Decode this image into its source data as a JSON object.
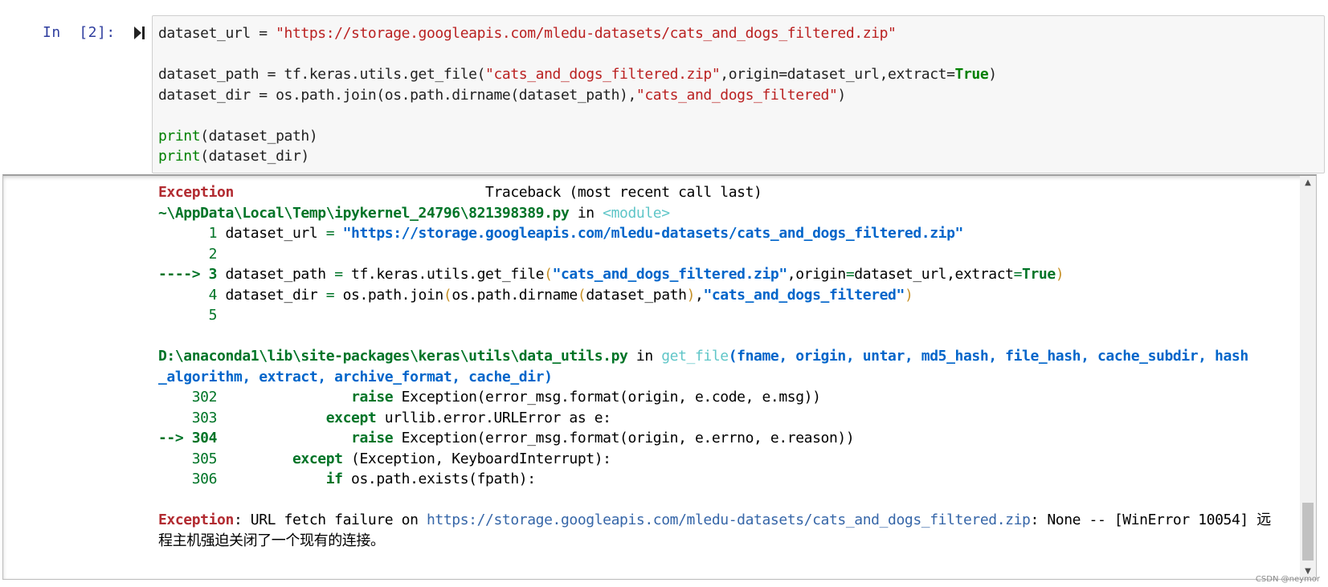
{
  "cell": {
    "prompt": "In  [2]:",
    "input_lines": [
      [
        "dataset_url = ",
        "\"https://storage.googleapis.com/mledu-datasets/cats_and_dogs_filtered.zip\""
      ],
      [],
      [
        "dataset_path = tf.keras.utils.get_file(",
        "\"cats_and_dogs_filtered.zip\"",
        ",origin=dataset_url,extract=",
        "True",
        ")"
      ],
      [
        "dataset_dir = os.path.join(os.path.dirname(dataset_path),",
        "\"cats_and_dogs_filtered\"",
        ")"
      ],
      [],
      [
        "print",
        "(dataset_path)"
      ],
      [
        "print",
        "(dataset_dir)"
      ]
    ]
  },
  "output": {
    "exception_header": {
      "name": "Exception",
      "spacer": "                              ",
      "traceback": "Traceback (most recent call last)"
    },
    "frame1": {
      "file": "~\\AppData\\Local\\Temp\\ipykernel_24796\\821398389.py",
      "in_word": " in ",
      "func": "<module>",
      "lines": [
        {
          "marker": "      ",
          "num": "1",
          "code": [
            " dataset_url ",
            "=",
            " ",
            "\"https://storage.googleapis.com/mledu-datasets/cats_and_dogs_filtered.zip\""
          ]
        },
        {
          "marker": "      ",
          "num": "2",
          "code": []
        },
        {
          "marker": "----> ",
          "num": "3",
          "code": [
            " dataset_path ",
            "=",
            " tf.keras.utils.get_file",
            "(",
            "\"cats_and_dogs_filtered.zip\"",
            ",",
            "origin",
            "=",
            "dataset_url",
            ",",
            "extract",
            "=",
            "True",
            ")"
          ]
        },
        {
          "marker": "      ",
          "num": "4",
          "code": [
            " dataset_dir ",
            "=",
            " os.path.join",
            "(",
            "os.path.dirname",
            "(",
            "dataset_path",
            ")",
            ",",
            "\"cats_and_dogs_filtered\"",
            ")"
          ]
        },
        {
          "marker": "      ",
          "num": "5",
          "code": []
        }
      ]
    },
    "frame2": {
      "file": "D:\\anaconda1\\lib\\site-packages\\keras\\utils\\data_utils.py",
      "in_word": " in ",
      "func": "get_file",
      "args_line1": "(fname, origin, untar, md5_hash, file_hash, cache_subdir, hash",
      "args_line2": "_algorithm, extract, archive_format, cache_dir)",
      "lines": [
        {
          "marker": "    ",
          "num": "302",
          "indent": "                ",
          "kw": "raise",
          "rest": " Exception(error_msg.format(origin, e.code, e.msg))"
        },
        {
          "marker": "    ",
          "num": "303",
          "indent": "             ",
          "kw": "except",
          "rest": " urllib.error.URLError as e:"
        },
        {
          "marker": "--> ",
          "num": "304",
          "indent": "                ",
          "kw": "raise",
          "rest": " Exception(error_msg.format(origin, e.errno, e.reason))"
        },
        {
          "marker": "    ",
          "num": "305",
          "indent": "         ",
          "kw": "except",
          "rest": " (Exception, KeyboardInterrupt):"
        },
        {
          "marker": "    ",
          "num": "306",
          "indent": "             ",
          "kw": "if",
          "rest": " os.path.exists(fpath):"
        }
      ]
    },
    "final_error": {
      "name": "Exception",
      "msg_prefix": ": URL fetch failure on ",
      "url": "https://storage.googleapis.com/mledu-datasets/cats_and_dogs_filtered.zip",
      "msg_suffix": ": None -- [WinError 10054] 远",
      "msg_line2": "程主机强迫关闭了一个现有的连接。"
    }
  },
  "scrollbar": {
    "up_glyph": "▲",
    "down_glyph": "▼"
  },
  "watermark": "CSDN @neymor",
  "colors": {
    "prompt": "#303f9f",
    "string": "#ba2121",
    "keyword": "#008000",
    "tb_red": "#b22b31",
    "tb_green": "#007427",
    "tb_blue": "#0065ca",
    "tb_cyan": "#60c6c8"
  }
}
